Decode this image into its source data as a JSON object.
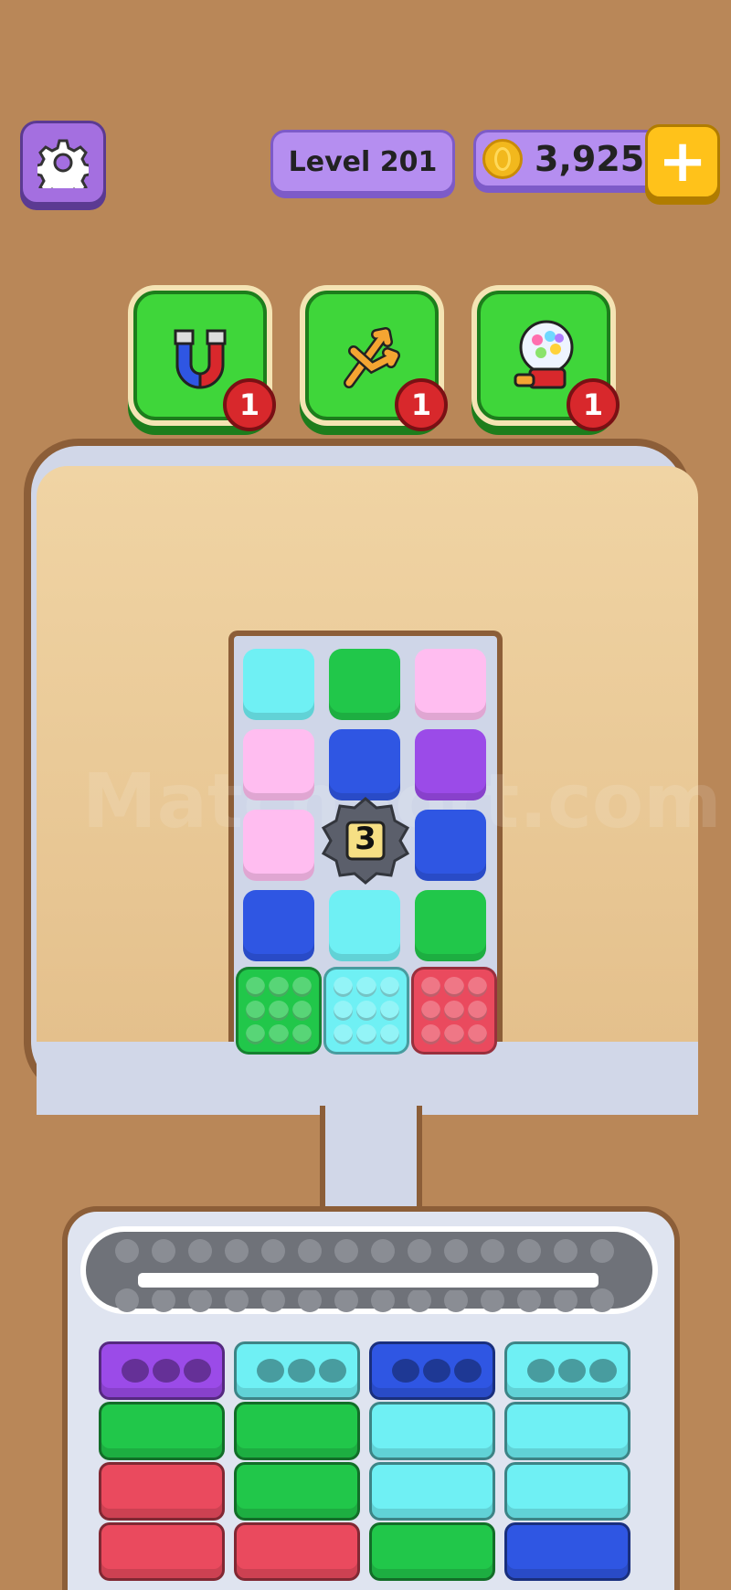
{
  "header": {
    "level_label": "Level 201",
    "coins": "3,925",
    "plus_label": "+"
  },
  "boosters": [
    {
      "name": "magnet",
      "count": "1"
    },
    {
      "name": "shuffle",
      "count": "1"
    },
    {
      "name": "gumball",
      "count": "1"
    }
  ],
  "watermark": "MatchSort.com",
  "board": {
    "rows": [
      [
        "cyan",
        "green",
        "pink"
      ],
      [
        "pink",
        "blue",
        "purple"
      ],
      [
        "pink",
        "locked",
        "blue"
      ],
      [
        "blue",
        "cyan",
        "green"
      ]
    ],
    "lock_count": "3",
    "front_row": [
      "green",
      "cyan",
      "red"
    ]
  },
  "stacks": [
    [
      "purple",
      "green",
      "red",
      "red"
    ],
    [
      "cyan",
      "green",
      "green",
      "red"
    ],
    [
      "blue",
      "cyan",
      "cyan",
      "green"
    ],
    [
      "cyan",
      "cyan",
      "cyan",
      "blue"
    ]
  ],
  "colors": {
    "cyan": "#6ff0f4",
    "green": "#21c74a",
    "pink": "#ffbdf0",
    "blue": "#2f56e3",
    "purple": "#9b4be8",
    "red": "#ea4a5e",
    "light_cyan": "#5ce6f3"
  }
}
